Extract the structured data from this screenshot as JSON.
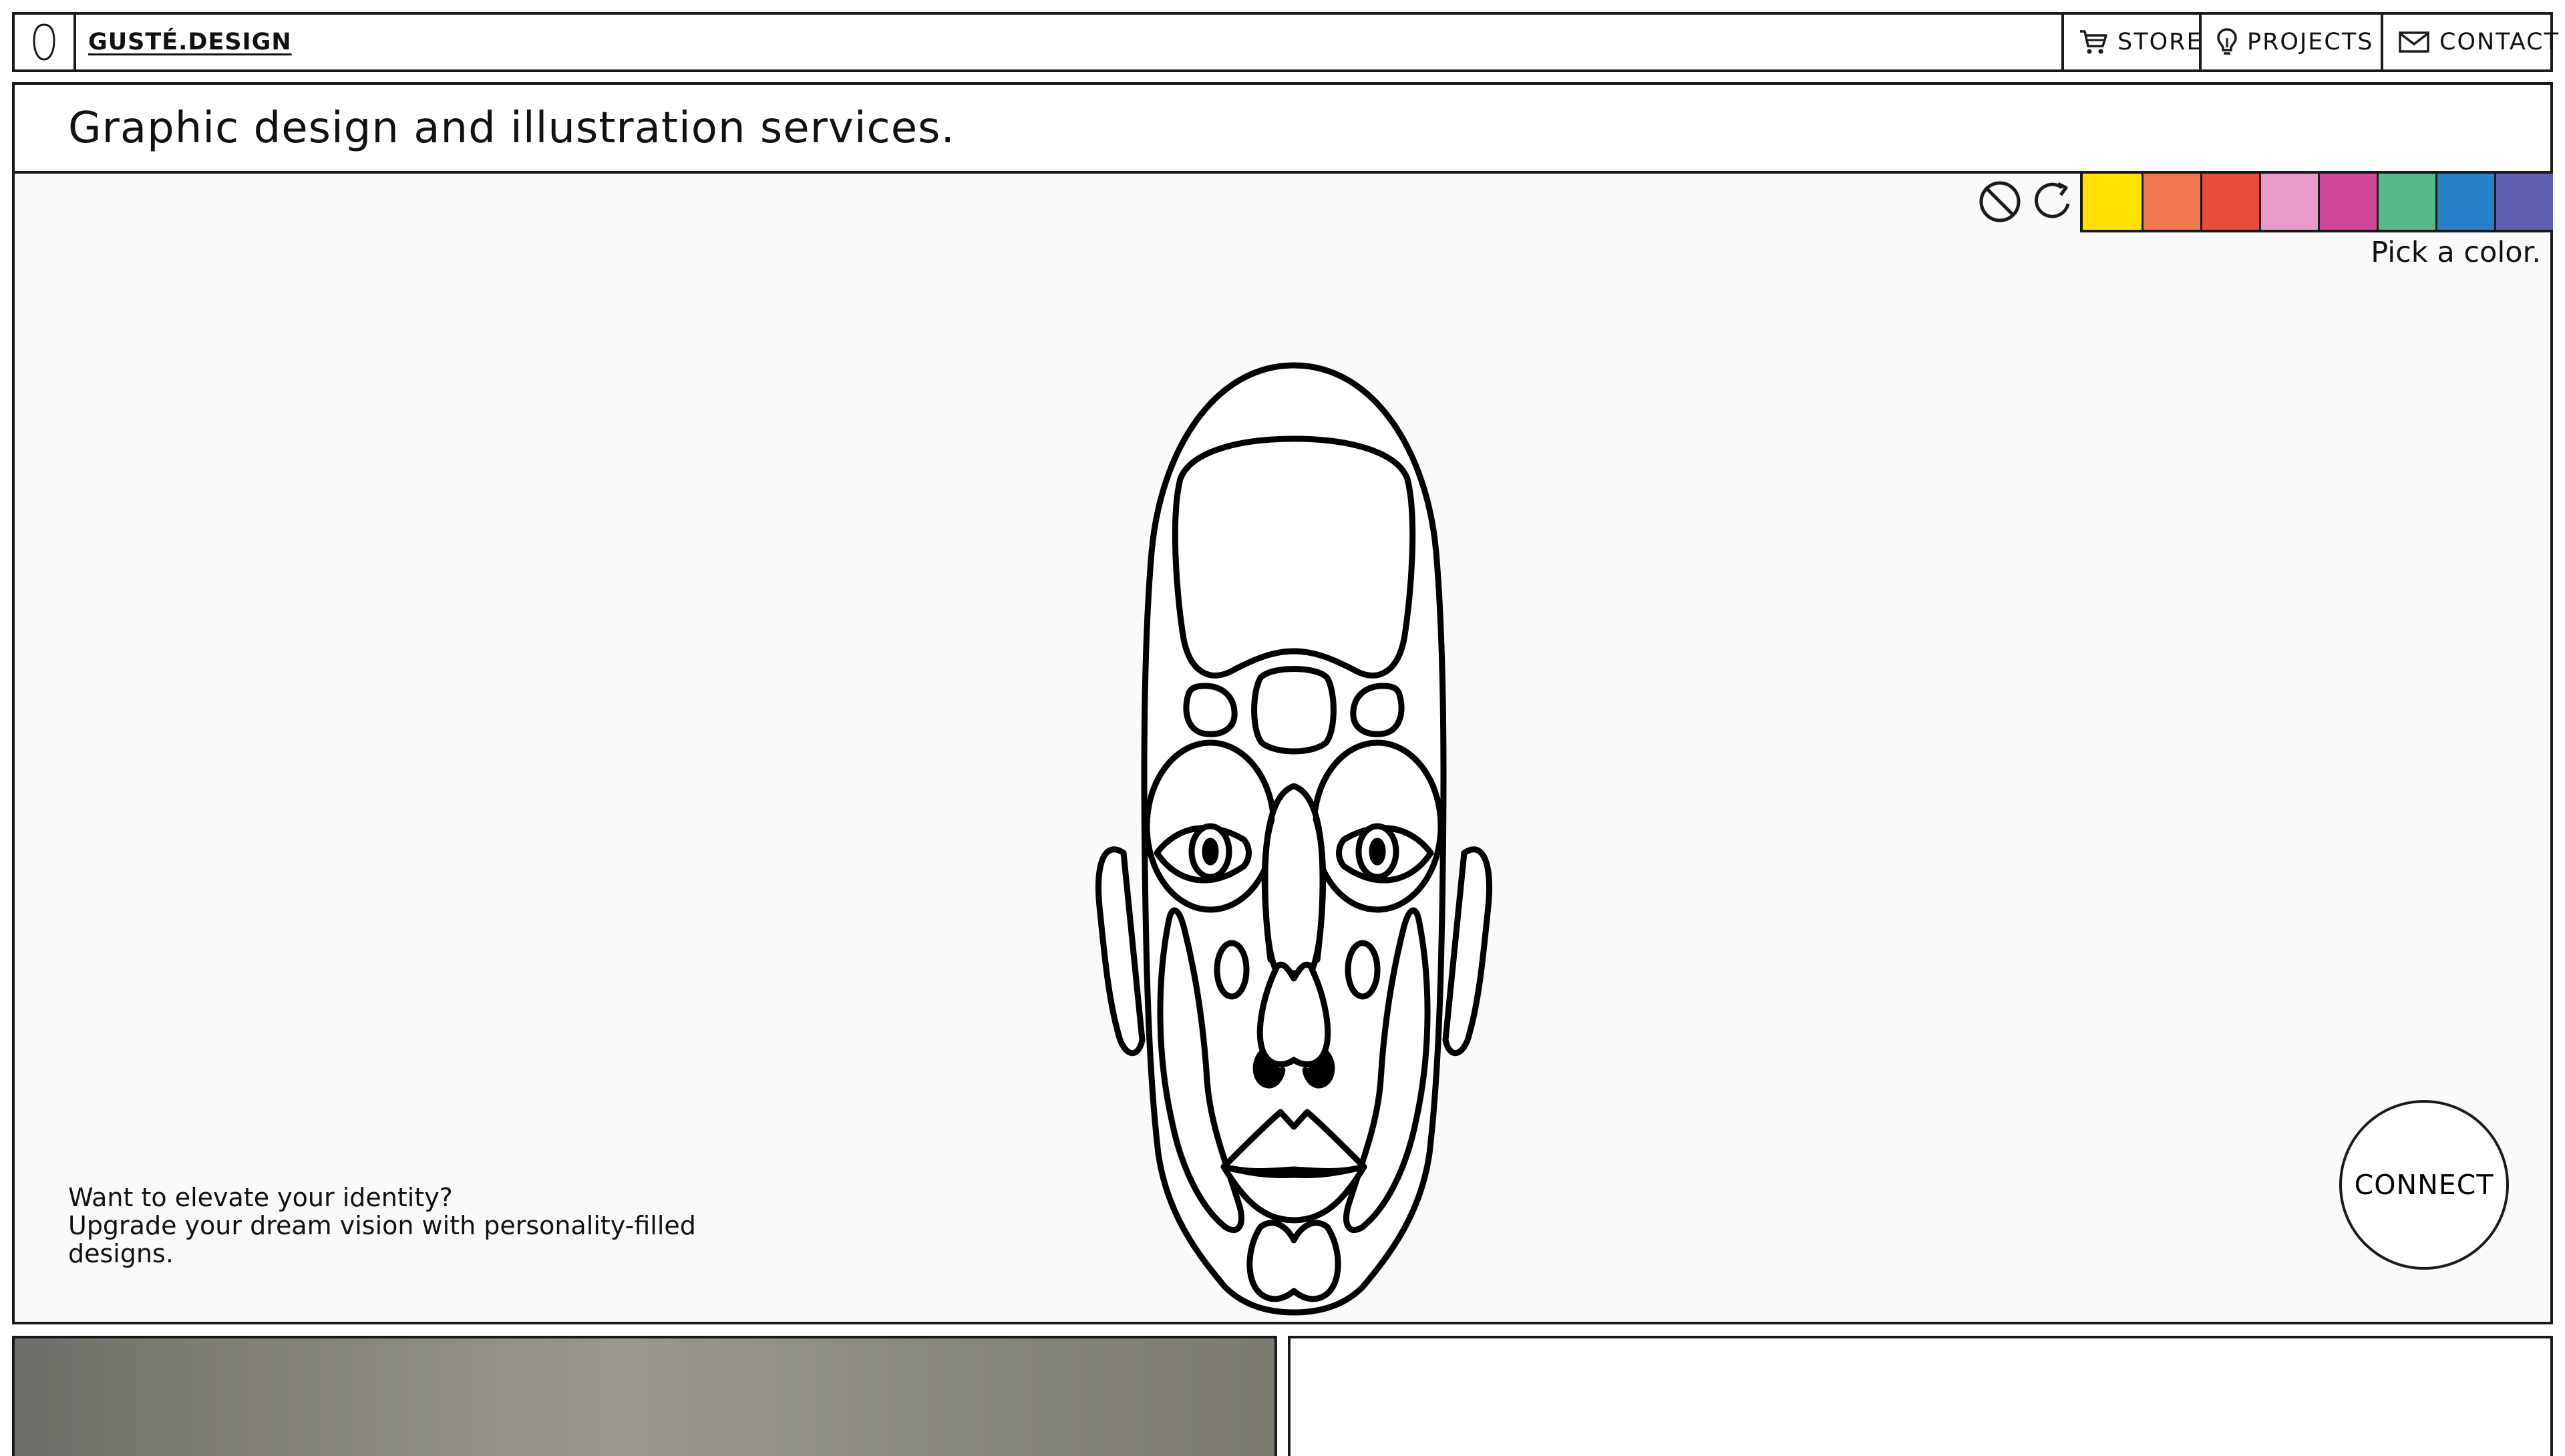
{
  "nav": {
    "brand": "GUSTÉ.DESIGN",
    "links": [
      {
        "label": "STORE",
        "icon": "cart-icon"
      },
      {
        "label": "PROJECTS",
        "icon": "lightbulb-icon"
      },
      {
        "label": "CONTACT",
        "icon": "mail-icon"
      }
    ]
  },
  "hero": {
    "title": "Graphic design and illustration services.",
    "pick_label": "Pick a color.",
    "tagline_line1": "Want to elevate your identity?",
    "tagline_line2": "Upgrade your dream vision with personality-filled designs.",
    "connect_label": "CONNECT"
  },
  "palette": {
    "tools": [
      "clear-icon",
      "reset-icon"
    ],
    "colors": [
      "#FFE000",
      "#F07850",
      "#E84B3E",
      "#E89AC8",
      "#D04898",
      "#58B888",
      "#2880C8",
      "#6060B0"
    ]
  }
}
